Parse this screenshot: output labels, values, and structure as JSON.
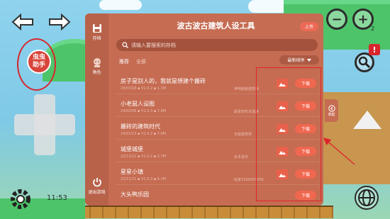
{
  "dialog": {
    "title": "波古波古建筑人设工具",
    "upload_label": "上传",
    "search_placeholder": "请输入要搜索的存档",
    "tabs": [
      {
        "label": "推荐",
        "active": true
      },
      {
        "label": "全部",
        "active": false
      }
    ],
    "sort_label": "最新排序",
    "download_label": "下载",
    "items": [
      {
        "name": "房子是别人的，我就是想建个搬砖",
        "meta": "24/03/18 ▪ V1.0.2 ▪ 1.1M",
        "author": "坤坤超级建筑师"
      },
      {
        "name": "小老鼠人设图",
        "meta": "24/02/06 ▪ V1.0.3 ▪ 7.6M",
        "author": "超喜欢吃冰淇淋"
      },
      {
        "name": "搬砖的建筑时代",
        "meta": "24/01/13 ▪ V1.0.2 ▪ 7.6M",
        "author": "无敌建筑师"
      },
      {
        "name": "城堡城堡",
        "meta": "22/12/21 ▪ V1.0.2 ▪ 2.7M",
        "author": "多多喜欢"
      },
      {
        "name": "星星小镇",
        "meta": "22/11/21 ▪ V1.0.3 ▪ 6.1M",
        "author": "玩家1595455000"
      },
      {
        "name": "大头鸭乐园",
        "meta": "",
        "author": ""
      }
    ]
  },
  "side_nav": {
    "archive_label": "存档",
    "character_label": "角色",
    "exit_label": "退出游戏"
  },
  "close_tab_label": "收起",
  "helper_badge_label": "虫虫助手",
  "game": {
    "time": "11:53",
    "badge_number": "2"
  },
  "colors": {
    "dialog_bg": "#c56c52",
    "accent_button": "#f0674f",
    "highlight": "#e0242c"
  }
}
